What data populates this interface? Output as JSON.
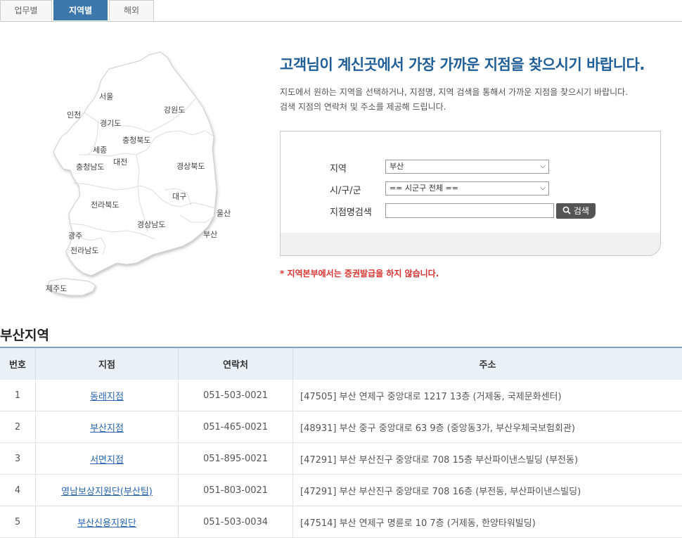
{
  "tabs": [
    {
      "label": "업무별",
      "active": false
    },
    {
      "label": "지역별",
      "active": true
    },
    {
      "label": "해외",
      "active": false
    }
  ],
  "map": {
    "regions": {
      "seoul": "서울",
      "incheon": "인천",
      "gyeonggi": "경기도",
      "gangwon": "강원도",
      "chungbuk": "충청북도",
      "sejong": "세종",
      "chungnam": "충청남도",
      "daejeon": "대전",
      "gyeongbuk": "경상북도",
      "daegu": "대구",
      "jeonbuk": "전라북도",
      "ulsan": "울산",
      "gyeongnam": "경상남도",
      "busan": "부산",
      "gwangju": "광주",
      "jeonnam": "전라남도",
      "jeju": "제주도"
    }
  },
  "header": {
    "headline": "고객님이 계신곳에서 가장 가까운 지점을 찾으시기 바랍니다.",
    "desc1": "지도에서 원하는 지역을 선택하거나, 지점명, 지역 검색을 통해서 가까운 지점을 찾으시기 바랍니다.",
    "desc2": "검색 지점의 연락처 및 주소를 제공해 드립니다."
  },
  "search": {
    "region_label": "지역",
    "region_value": "부산",
    "city_label": "시/구/군",
    "city_value": "== 시군구 전체 ==",
    "name_label": "지점명검색",
    "name_value": "",
    "button_label": "검색"
  },
  "notice": "* 지역본부에서는 증권발급을 하지 않습니다.",
  "section_title": "부산지역",
  "table": {
    "headers": [
      "번호",
      "지점",
      "연락처",
      "주소"
    ],
    "rows": [
      {
        "no": "1",
        "branch": "동래지점",
        "tel": "051-503-0021",
        "addr": "[47505] 부산 연제구 중앙대로 1217 13층 (거제동, 국제문화센터)"
      },
      {
        "no": "2",
        "branch": "부산지점",
        "tel": "051-465-0021",
        "addr": "[48931] 부산 중구 중앙대로 63 9층 (중앙동3가, 부산우체국보험회관)"
      },
      {
        "no": "3",
        "branch": "서면지점",
        "tel": "051-895-0021",
        "addr": "[47291] 부산 부산진구 중앙대로 708 15층 부산파이낸스빌딩 (부전동)"
      },
      {
        "no": "4",
        "branch": "영남보상지원단(부산팀)",
        "tel": "051-803-0021",
        "addr": "[47291] 부산 부산진구 중앙대로 708 16층 (부전동, 부산파이낸스빌딩)"
      },
      {
        "no": "5",
        "branch": "부산신용지원단",
        "tel": "051-503-0034",
        "addr": "[47514] 부산 연제구 명륜로 10 7층 (거제동, 한양타워빌딩)"
      }
    ]
  }
}
